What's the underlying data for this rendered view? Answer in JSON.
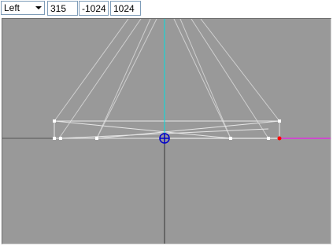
{
  "toolbar": {
    "view": "Left",
    "x": "315",
    "y": "-1024",
    "z": "1024"
  },
  "viewport": {
    "background": "#999999",
    "colors": {
      "wire": "#c8c8c8",
      "frame": "#e6e6e6",
      "vertical_axis": "#00e0e0",
      "horizontal_axis": "#ff00ff",
      "origin": "#0000cc"
    }
  }
}
